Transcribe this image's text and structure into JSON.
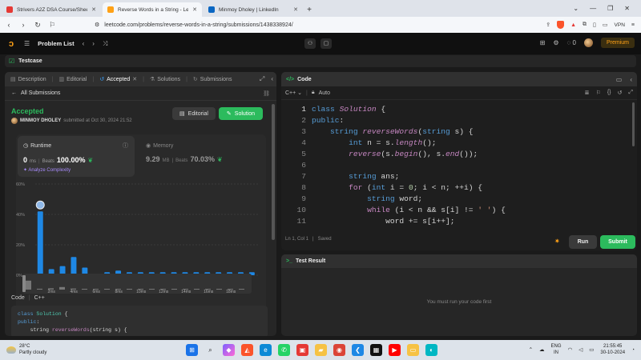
{
  "browser": {
    "tabs": [
      {
        "title": "Strivers A2Z DSA Course/Sheet - Co",
        "color": "#e53935",
        "active": false
      },
      {
        "title": "Reverse Words in a String - Lee",
        "color": "#ffa116",
        "active": true
      },
      {
        "title": "Minmoy Dholey | LinkedIn",
        "color": "#0a66c2",
        "active": false
      }
    ],
    "new_tab": "+",
    "url": "leetcode.com/problems/reverse-words-in-a-string/submissions/1438338924/",
    "vpn": "VPN"
  },
  "lc_nav": {
    "problem_list": "Problem List",
    "streak": "0",
    "premium": "Premium"
  },
  "testcase_strip": "Testcase",
  "left": {
    "tabs": [
      "Description",
      "Editorial",
      "Accepted",
      "Solutions",
      "Submissions"
    ],
    "all_submissions": "All Submissions",
    "status": "Accepted",
    "user": "MINMOY DHOLEY",
    "submitted": "submitted at Oct 30, 2024 21:52",
    "btn_editorial": "Editorial",
    "btn_solution": "Solution",
    "runtime": {
      "title": "Runtime",
      "value": "0",
      "unit": "ms",
      "sep": "|",
      "beats_label": "Beats",
      "beats": "100.00%",
      "analyze": "Analyze Complexity"
    },
    "memory": {
      "title": "Memory",
      "value": "9.29",
      "unit": "MB",
      "sep": "|",
      "beats_label": "Beats",
      "beats": "70.03%"
    },
    "code_lang_label": "Code",
    "code_lang": "C++",
    "code_preview": [
      "class Solution {",
      "public:",
      "    string reverseWords(string s) {"
    ]
  },
  "chart_data": {
    "type": "bar",
    "title": "",
    "y_ticks": [
      "60%",
      "40%",
      "20%",
      "0%"
    ],
    "ylim": [
      0,
      60
    ],
    "x_tick_labels": [
      "2ms",
      "4ms",
      "6ms",
      "8ms",
      "10ms",
      "12ms",
      "14ms",
      "16ms",
      "18ms"
    ],
    "values": [
      42,
      4,
      6,
      12,
      5,
      1,
      2,
      3,
      2,
      2,
      2,
      2,
      2,
      2,
      2,
      2,
      2,
      2,
      2,
      2
    ],
    "highlight_index": 0,
    "colors": {
      "bar": "#1e88e5",
      "grid": "#3a3a3a",
      "axis_text": "#888888"
    }
  },
  "editor": {
    "header": "Code",
    "lang": "C++",
    "auto": "Auto",
    "status_pos": "Ln 1, Col 1",
    "status_saved": "Saved",
    "run": "Run",
    "submit": "Submit"
  },
  "test_result": {
    "title": "Test Result",
    "message": "You must run your code first"
  },
  "taskbar": {
    "temp": "28°C",
    "weather": "Partly cloudy",
    "lang1": "ENG",
    "lang2": "IN",
    "time": "21:55:45",
    "date": "30-10-2024"
  }
}
